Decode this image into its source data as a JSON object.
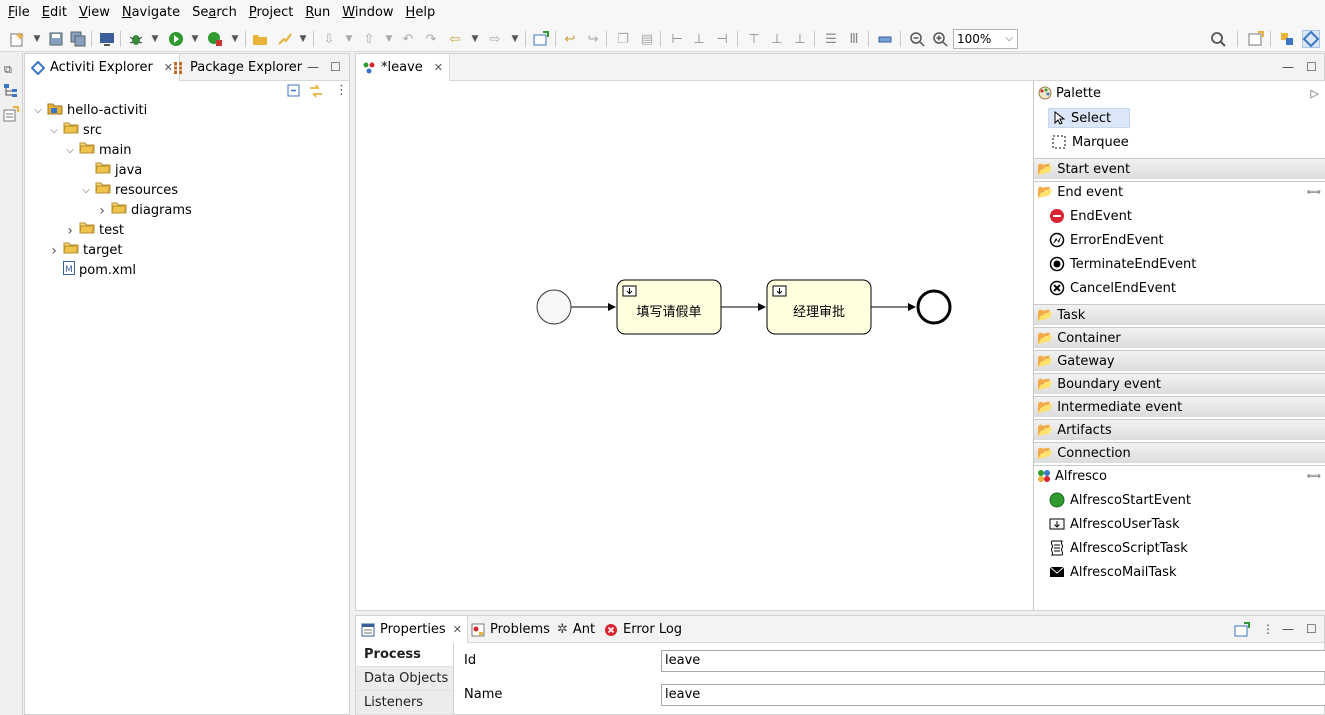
{
  "menu": [
    "File",
    "Edit",
    "View",
    "Navigate",
    "Search",
    "Project",
    "Run",
    "Window",
    "Help"
  ],
  "menu_mnemonic": [
    "F",
    "E",
    "V",
    "N",
    "a",
    "P",
    "R",
    "W",
    "H"
  ],
  "toolbar": {
    "zoom": "100%"
  },
  "explorer": {
    "tabs": [
      "Activiti Explorer",
      "Package Explorer"
    ],
    "tree": [
      {
        "label": "hello-activiti",
        "level": 0,
        "twisty": "open",
        "icon": "project-icon"
      },
      {
        "label": "src",
        "level": 1,
        "twisty": "open",
        "icon": "folder-icon"
      },
      {
        "label": "main",
        "level": 2,
        "twisty": "open",
        "icon": "folder-icon"
      },
      {
        "label": "java",
        "level": 3,
        "twisty": "none",
        "icon": "folder-icon"
      },
      {
        "label": "resources",
        "level": 3,
        "twisty": "open",
        "icon": "folder-icon"
      },
      {
        "label": "diagrams",
        "level": 4,
        "twisty": "closed",
        "icon": "folder-icon"
      },
      {
        "label": "test",
        "level": 2,
        "twisty": "closed",
        "icon": "folder-icon"
      },
      {
        "label": "target",
        "level": 1,
        "twisty": "closed",
        "icon": "folder-icon"
      },
      {
        "label": "pom.xml",
        "level": 1,
        "twisty": "none",
        "icon": "maven-file-icon"
      }
    ]
  },
  "editor": {
    "tab": "*leave",
    "diagram": {
      "task1": "填写请假单",
      "task2": "经理审批"
    }
  },
  "palette": {
    "title": "Palette",
    "tools": [
      "Select",
      "Marquee"
    ],
    "drawers": [
      {
        "label": "Start event",
        "open": false
      },
      {
        "label": "End event",
        "open": true,
        "items": [
          "EndEvent",
          "ErrorEndEvent",
          "TerminateEndEvent",
          "CancelEndEvent"
        ]
      },
      {
        "label": "Task",
        "open": false
      },
      {
        "label": "Container",
        "open": false
      },
      {
        "label": "Gateway",
        "open": false
      },
      {
        "label": "Boundary event",
        "open": false
      },
      {
        "label": "Intermediate event",
        "open": false
      },
      {
        "label": "Artifacts",
        "open": false
      },
      {
        "label": "Connection",
        "open": false
      },
      {
        "label": "Alfresco",
        "open": true,
        "items": [
          "AlfrescoStartEvent",
          "AlfrescoUserTask",
          "AlfrescoScriptTask",
          "AlfrescoMailTask"
        ]
      }
    ]
  },
  "properties": {
    "tabs": [
      "Properties",
      "Problems",
      "Ant",
      "Error Log"
    ],
    "sections": [
      "Process",
      "Data Objects",
      "Listeners"
    ],
    "fields": [
      {
        "label": "Id",
        "value": "leave"
      },
      {
        "label": "Name",
        "value": "leave"
      }
    ]
  },
  "colors": {
    "task_fill": "#ffffe0",
    "accent_blue": "#3a76c6",
    "end_red": "#d9232e",
    "start_green": "#2f9a2f",
    "folder": "#e8b23c"
  }
}
